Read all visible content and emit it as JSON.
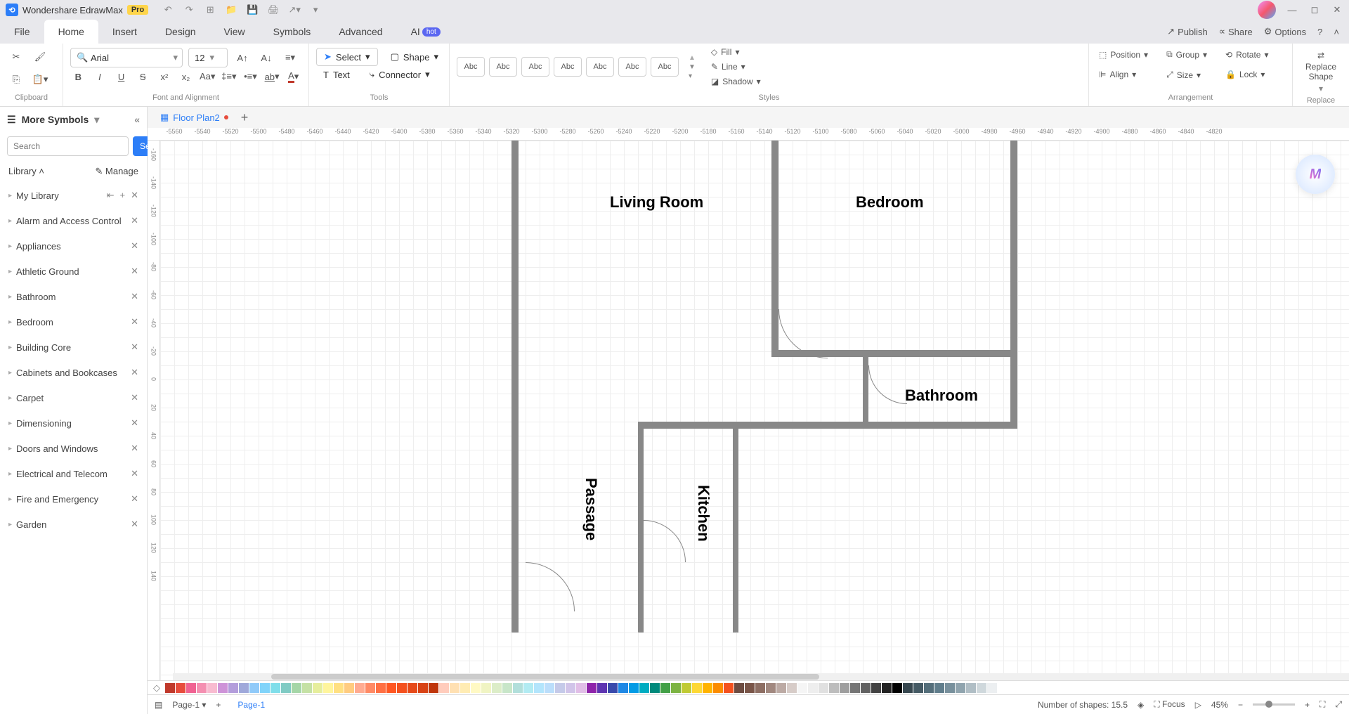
{
  "app": {
    "title": "Wondershare EdrawMax",
    "badge": "Pro"
  },
  "menu": {
    "tabs": [
      "File",
      "Home",
      "Insert",
      "Design",
      "View",
      "Symbols",
      "Advanced",
      "AI"
    ],
    "active": 1,
    "ai_badge": "hot",
    "right": {
      "publish": "Publish",
      "share": "Share",
      "options": "Options"
    }
  },
  "ribbon": {
    "clipboard": "Clipboard",
    "font": {
      "name": "Arial",
      "size": "12",
      "group": "Font and Alignment"
    },
    "tools": {
      "select": "Select",
      "shape": "Shape",
      "text": "Text",
      "connector": "Connector",
      "group": "Tools"
    },
    "styles": {
      "label": "Abc",
      "group": "Styles",
      "fill": "Fill",
      "line": "Line",
      "shadow": "Shadow"
    },
    "arrange": {
      "position": "Position",
      "group_btn": "Group",
      "rotate": "Rotate",
      "align": "Align",
      "size": "Size",
      "lock": "Lock",
      "group": "Arrangement"
    },
    "replace": {
      "btn": "Replace\nShape",
      "group": "Replace"
    }
  },
  "sidebar": {
    "title": "More Symbols",
    "search_placeholder": "Search",
    "search_btn": "Search",
    "library": "Library",
    "manage": "Manage",
    "items": [
      "My Library",
      "Alarm and Access Control",
      "Appliances",
      "Athletic Ground",
      "Bathroom",
      "Bedroom",
      "Building Core",
      "Cabinets and Bookcases",
      "Carpet",
      "Dimensioning",
      "Doors and Windows",
      "Electrical and Telecom",
      "Fire and Emergency",
      "Garden"
    ]
  },
  "doc": {
    "tab": "Floor Plan2"
  },
  "ruler_h": [
    "-5560",
    "-5540",
    "-5520",
    "-5500",
    "-5480",
    "-5460",
    "-5440",
    "-5420",
    "-5400",
    "-5380",
    "-5360",
    "-5340",
    "-5320",
    "-5300",
    "-5280",
    "-5260",
    "-5240",
    "-5220",
    "-5200",
    "-5180",
    "-5160",
    "-5140",
    "-5120",
    "-5100",
    "-5080",
    "-5060",
    "-5040",
    "-5020",
    "-5000",
    "-4980",
    "-4960",
    "-4940",
    "-4920",
    "-4900",
    "-4880",
    "-4860",
    "-4840",
    "-4820"
  ],
  "ruler_v": [
    "-160",
    "-140",
    "-120",
    "-100",
    "-80",
    "-60",
    "-40",
    "-20",
    "0",
    "20",
    "40",
    "60",
    "80",
    "100",
    "120",
    "140"
  ],
  "rooms": {
    "living": "Living Room",
    "bedroom": "Bedroom",
    "bathroom": "Bathroom",
    "passage": "Passage",
    "kitchen": "Kitchen"
  },
  "colors": [
    "#c0392b",
    "#e74c3c",
    "#f06292",
    "#f48fb1",
    "#f8bbd0",
    "#ce93d8",
    "#b39ddb",
    "#9fa8da",
    "#90caf9",
    "#81d4fa",
    "#80deea",
    "#80cbc4",
    "#a5d6a7",
    "#c5e1a5",
    "#e6ee9c",
    "#fff59d",
    "#ffe082",
    "#ffcc80",
    "#ffab91",
    "#ff8a65",
    "#ff7043",
    "#ff5722",
    "#f4511e",
    "#e64a19",
    "#d84315",
    "#bf360c",
    "#ffccbc",
    "#ffe0b2",
    "#ffecb3",
    "#fff9c4",
    "#f0f4c3",
    "#dcedc8",
    "#c8e6c9",
    "#b2dfdb",
    "#b2ebf2",
    "#b3e5fc",
    "#bbdefb",
    "#c5cae9",
    "#d1c4e9",
    "#e1bee7",
    "#8e24aa",
    "#5e35b1",
    "#3949ab",
    "#1e88e5",
    "#039be5",
    "#00acc1",
    "#00897b",
    "#43a047",
    "#7cb342",
    "#c0ca33",
    "#fdd835",
    "#ffb300",
    "#fb8c00",
    "#f4511e",
    "#6d4c41",
    "#795548",
    "#8d6e63",
    "#a1887f",
    "#bcaaa4",
    "#d7ccc8",
    "#f5f5f5",
    "#eeeeee",
    "#e0e0e0",
    "#bdbdbd",
    "#9e9e9e",
    "#757575",
    "#616161",
    "#424242",
    "#212121",
    "#000000",
    "#37474f",
    "#455a64",
    "#546e7a",
    "#607d8b",
    "#78909c",
    "#90a4ae",
    "#b0bec5",
    "#cfd8dc",
    "#eceff1",
    "#ffffff"
  ],
  "status": {
    "page_tab": "Page-1",
    "page": "Page-1",
    "shapes": "Number of shapes: 15.5",
    "focus": "Focus",
    "zoom": "45%"
  }
}
